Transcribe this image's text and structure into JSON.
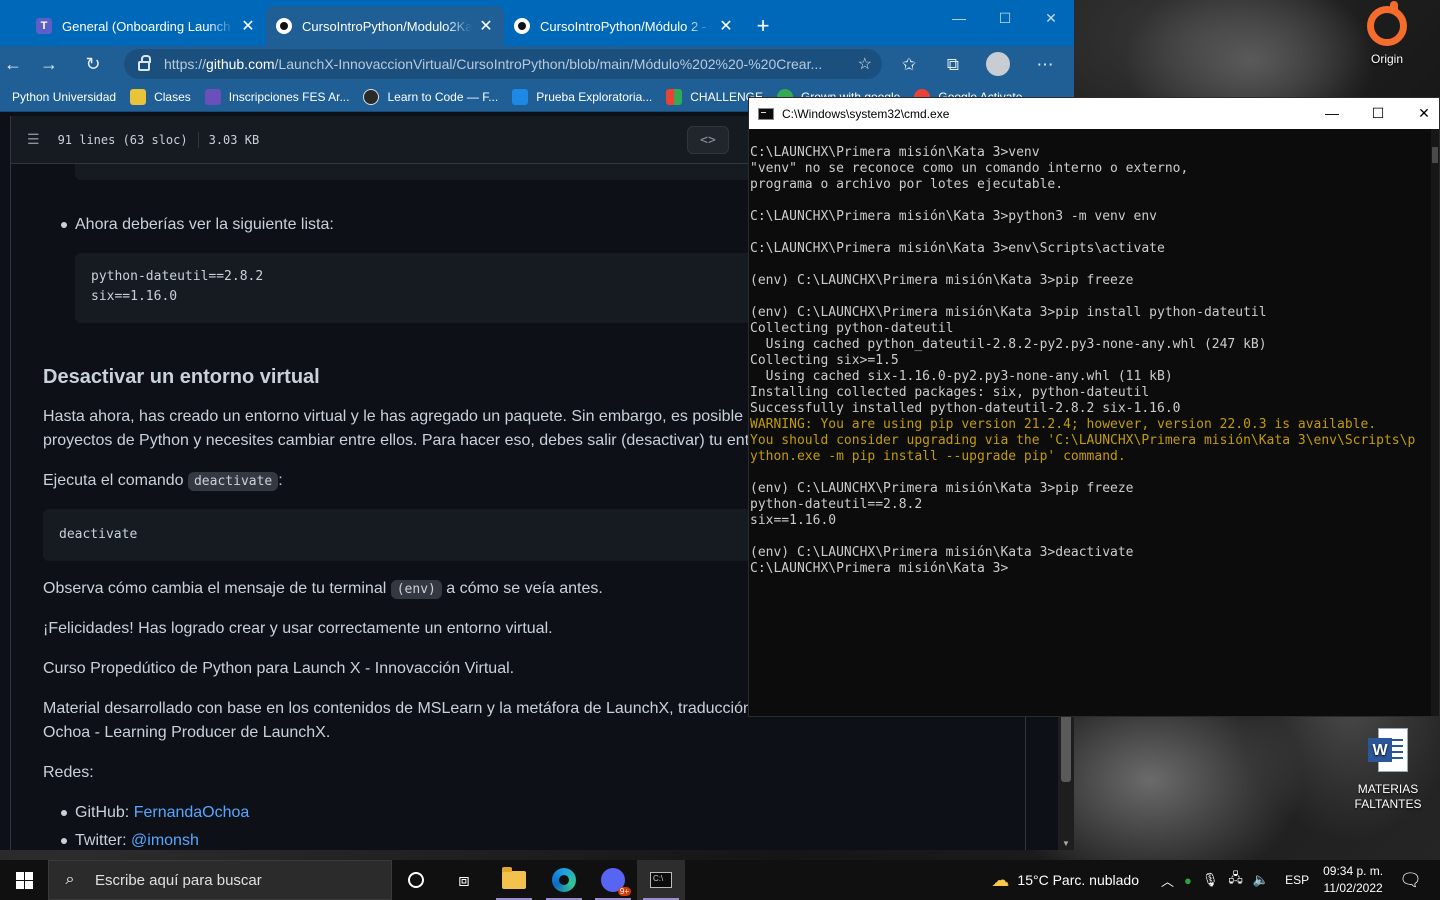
{
  "browser": {
    "tabs": [
      {
        "label": "General (Onboarding Launch X B",
        "icon": "teams-icon"
      },
      {
        "label": "CursoIntroPython/Modulo2Kata",
        "icon": "github-icon"
      },
      {
        "label": "CursoIntroPython/Módulo 2 - Cr",
        "icon": "github-icon"
      }
    ],
    "new_tab_label": "+",
    "url_prefix": "https://",
    "url_host": "github.com",
    "url_path": "/LaunchX-InnovaccionVirtual/CursoIntroPython/blob/main/Módulo%202%20-%20Crear...",
    "bookmarks": [
      {
        "label": "Python Universidad",
        "color": "#d13438"
      },
      {
        "label": "Clases",
        "color": "#e8c43a"
      },
      {
        "label": "Inscripciones FES Ar...",
        "color": "#6b4fbb"
      },
      {
        "label": "Learn to Code — F...",
        "color": "#2a2a2a"
      },
      {
        "label": "Prueba Exploratoria...",
        "color": "#1e88e5"
      },
      {
        "label": "CHALLENGE",
        "color": "#f4b400"
      },
      {
        "label": "Grown with google",
        "color": "#34a853"
      },
      {
        "label": "Google Activate",
        "color": "#ea4335"
      }
    ]
  },
  "file": {
    "lines": "91 lines (63 sloc)",
    "size": "3.03 KB",
    "code_btn": "<>"
  },
  "markdown": {
    "bullet1": "Ahora deberías ver la siguiente lista:",
    "code1_line1": "python-dateutil==2.8.2",
    "code1_line2": "six==1.16.0",
    "heading": "Desactivar un entorno virtual",
    "para1_line1": "Hasta ahora, has creado un entorno virtual y le has agregado un paquete. Sin embargo, es posible q",
    "para1_line2": "proyectos de Python y necesites cambiar entre ellos. Para hacer eso, debes salir (desactivar) tu entorn",
    "para2_before": "Ejecuta el comando ",
    "para2_code": "deactivate",
    "para2_after": ":",
    "code2": "deactivate",
    "para3_before": "Observa cómo cambia el mensaje de tu terminal ",
    "para3_code": "(env)",
    "para3_after": " a cómo se veía antes.",
    "para4": "¡Felicidades! Has logrado crear y usar correctamente un entorno virtual.",
    "para5": "Curso Propedútico de Python para Launch X - Innovacción Virtual.",
    "para6_line1": "Material desarrollado con base en los contenidos de MSLearn y la metáfora de LaunchX, traducción",
    "para6_line2": "Ochoa - Learning Producer de LaunchX.",
    "para7": "Redes:",
    "social": [
      {
        "prefix": "GitHub: ",
        "link": "FernandaOchoa"
      },
      {
        "prefix": "Twitter: ",
        "link": "@imonsh"
      }
    ]
  },
  "cmd": {
    "title": "C:\\Windows\\system32\\cmd.exe",
    "lines": [
      {
        "text": "C:\\LAUNCHX\\Primera misión\\Kata 3>venv",
        "warn": false
      },
      {
        "text": "\"venv\" no se reconoce como un comando interno o externo,",
        "warn": false
      },
      {
        "text": "programa o archivo por lotes ejecutable.",
        "warn": false
      },
      {
        "text": "",
        "warn": false
      },
      {
        "text": "C:\\LAUNCHX\\Primera misión\\Kata 3>python3 -m venv env",
        "warn": false
      },
      {
        "text": "",
        "warn": false
      },
      {
        "text": "C:\\LAUNCHX\\Primera misión\\Kata 3>env\\Scripts\\activate",
        "warn": false
      },
      {
        "text": "",
        "warn": false
      },
      {
        "text": "(env) C:\\LAUNCHX\\Primera misión\\Kata 3>pip freeze",
        "warn": false
      },
      {
        "text": "",
        "warn": false
      },
      {
        "text": "(env) C:\\LAUNCHX\\Primera misión\\Kata 3>pip install python-dateutil",
        "warn": false
      },
      {
        "text": "Collecting python-dateutil",
        "warn": false
      },
      {
        "text": "  Using cached python_dateutil-2.8.2-py2.py3-none-any.whl (247 kB)",
        "warn": false
      },
      {
        "text": "Collecting six>=1.5",
        "warn": false
      },
      {
        "text": "  Using cached six-1.16.0-py2.py3-none-any.whl (11 kB)",
        "warn": false
      },
      {
        "text": "Installing collected packages: six, python-dateutil",
        "warn": false
      },
      {
        "text": "Successfully installed python-dateutil-2.8.2 six-1.16.0",
        "warn": false
      },
      {
        "text": "WARNING: You are using pip version 21.2.4; however, version 22.0.3 is available.",
        "warn": true
      },
      {
        "text": "You should consider upgrading via the 'C:\\LAUNCHX\\Primera misión\\Kata 3\\env\\Scripts\\p",
        "warn": true
      },
      {
        "text": "ython.exe -m pip install --upgrade pip' command.",
        "warn": true
      },
      {
        "text": "",
        "warn": false
      },
      {
        "text": "(env) C:\\LAUNCHX\\Primera misión\\Kata 3>pip freeze",
        "warn": false
      },
      {
        "text": "python-dateutil==2.8.2",
        "warn": false
      },
      {
        "text": "six==1.16.0",
        "warn": false
      },
      {
        "text": "",
        "warn": false
      },
      {
        "text": "(env) C:\\LAUNCHX\\Primera misión\\Kata 3>deactivate",
        "warn": false
      },
      {
        "text": "C:\\LAUNCHX\\Primera misión\\Kata 3>",
        "warn": false
      }
    ]
  },
  "desktop": {
    "origin_label": "Origin",
    "word_label_line1": "MATERIAS",
    "word_label_line2": "FALTANTES"
  },
  "taskbar": {
    "search_placeholder": "Escribe aquí para buscar",
    "weather": "15°C  Parc. nublado",
    "language": "ESP",
    "time": "09:34 p. m.",
    "date": "11/02/2022",
    "discord_badge": "9+"
  }
}
